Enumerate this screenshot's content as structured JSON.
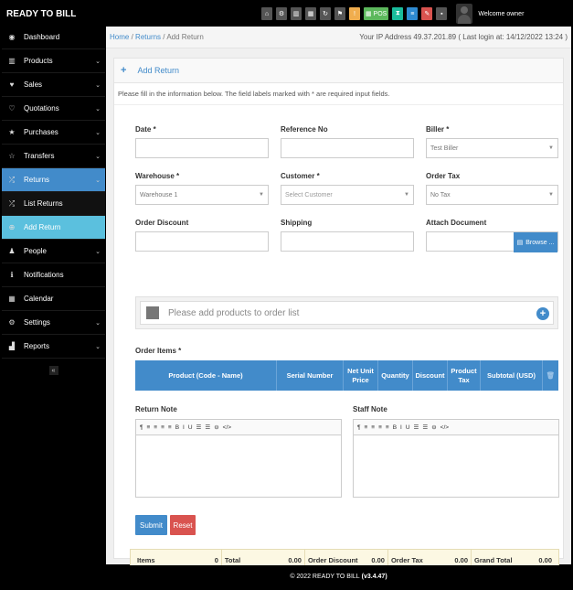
{
  "brand": "READY TO BILL",
  "toolbar": {
    "buttons": [
      {
        "icon": "home-icon",
        "glyph": "⌂",
        "color": "#555555"
      },
      {
        "icon": "cogs-icon",
        "glyph": "⚙",
        "color": "#555555"
      },
      {
        "icon": "barcode-icon",
        "glyph": "▥",
        "color": "#555555"
      },
      {
        "icon": "calendar-icon",
        "glyph": "▦",
        "color": "#555555"
      },
      {
        "icon": "refresh-icon",
        "glyph": "↻",
        "color": "#555555"
      },
      {
        "icon": "flag-icon",
        "glyph": "⚑",
        "color": "#555555"
      },
      {
        "icon": "alert-icon",
        "glyph": "!",
        "color": "#f0ad4e"
      },
      {
        "icon": "pos-icon",
        "glyph": "▦ POS",
        "color": "#5cb85c"
      },
      {
        "icon": "hourglass-icon",
        "glyph": "⧗",
        "color": "#1abc9c"
      },
      {
        "icon": "list-icon",
        "glyph": "≡",
        "color": "#2e8bd1"
      },
      {
        "icon": "eraser-icon",
        "glyph": "✎",
        "color": "#d9534f"
      },
      {
        "icon": "grid-icon",
        "glyph": "▪",
        "color": "#555555"
      }
    ],
    "welcome": "Welcome owner"
  },
  "sidebar": {
    "items": [
      {
        "label": "Dashboard",
        "icon": "dashboard-icon",
        "glyph": "◉",
        "chevron": false,
        "state": ""
      },
      {
        "label": "Products",
        "icon": "barcode-icon",
        "glyph": "▥",
        "chevron": true,
        "state": ""
      },
      {
        "label": "Sales",
        "icon": "heart-icon",
        "glyph": "♥",
        "chevron": true,
        "state": ""
      },
      {
        "label": "Quotations",
        "icon": "heart-outline-icon",
        "glyph": "♡",
        "chevron": true,
        "state": ""
      },
      {
        "label": "Purchases",
        "icon": "star-icon",
        "glyph": "★",
        "chevron": true,
        "state": ""
      },
      {
        "label": "Transfers",
        "icon": "star-outline-icon",
        "glyph": "☆",
        "chevron": true,
        "state": ""
      },
      {
        "label": "Returns",
        "icon": "random-icon",
        "glyph": "⤮",
        "chevron": true,
        "state": "active"
      },
      {
        "label": "List Returns",
        "icon": "random-icon",
        "glyph": "⤮",
        "chevron": false,
        "state": "sub"
      },
      {
        "label": "Add Return",
        "icon": "plus-circle-icon",
        "glyph": "⊕",
        "chevron": false,
        "state": "subactive"
      },
      {
        "label": "People",
        "icon": "users-icon",
        "glyph": "♟",
        "chevron": true,
        "state": ""
      },
      {
        "label": "Notifications",
        "icon": "info-icon",
        "glyph": "ℹ",
        "chevron": false,
        "state": ""
      },
      {
        "label": "Calendar",
        "icon": "calendar-icon",
        "glyph": "▦",
        "chevron": false,
        "state": ""
      },
      {
        "label": "Settings",
        "icon": "gear-icon",
        "glyph": "⚙",
        "chevron": true,
        "state": ""
      },
      {
        "label": "Reports",
        "icon": "bar-chart-icon",
        "glyph": "▟",
        "chevron": true,
        "state": ""
      }
    ],
    "collapse": "«"
  },
  "breadcrumb": {
    "home": "Home",
    "sep": "/",
    "returns": "Returns",
    "current": "Add Return"
  },
  "ip_info": "Your IP Address 49.37.201.89 ( Last login at: 14/12/2022 13:24 )",
  "form": {
    "title": "Add Return",
    "intro": "Please fill in the information below. The field labels marked with * are required input fields.",
    "date_label": "Date *",
    "date_value": "",
    "reference_label": "Reference No",
    "reference_value": "",
    "biller_label": "Biller *",
    "biller_value": "Test Biller",
    "warehouse_label": "Warehouse *",
    "warehouse_value": "Warehouse 1",
    "customer_label": "Customer *",
    "customer_placeholder": "Select Customer",
    "ordertax_label": "Order Tax",
    "ordertax_value": "No Tax",
    "discount_label": "Order Discount",
    "shipping_label": "Shipping",
    "attach_label": "Attach Document",
    "browse_label": "Browse ...",
    "product_placeholder": "Please add products to order list",
    "order_items_label": "Order Items *",
    "columns": [
      "Product (Code - Name)",
      "Serial Number",
      "Net Unit Price",
      "Quantity",
      "Discount",
      "Product Tax",
      "Subtotal (USD)",
      "🗑"
    ],
    "return_note_label": "Return Note",
    "staff_note_label": "Staff Note",
    "editor_tools": [
      "¶",
      "≡",
      "≡",
      "≡",
      "≡",
      "B",
      "I",
      "U",
      "☰",
      "☰",
      "⊖",
      "</>"
    ],
    "submit_label": "Submit",
    "reset_label": "Reset"
  },
  "totals": [
    {
      "label": "Items",
      "value": "0"
    },
    {
      "label": "Total",
      "value": "0.00"
    },
    {
      "label": "Order Discount",
      "value": "0.00"
    },
    {
      "label": "Order Tax",
      "value": "0.00"
    },
    {
      "label": "Grand Total",
      "value": "0.00"
    }
  ],
  "footer": {
    "text": "© 2022 READY TO BILL",
    "version": "(v3.4.47)"
  },
  "colors": {
    "primary": "#428bca",
    "active_sub": "#5bc0de",
    "reset": "#d9534f",
    "totals_bg": "#fcf8e3"
  }
}
